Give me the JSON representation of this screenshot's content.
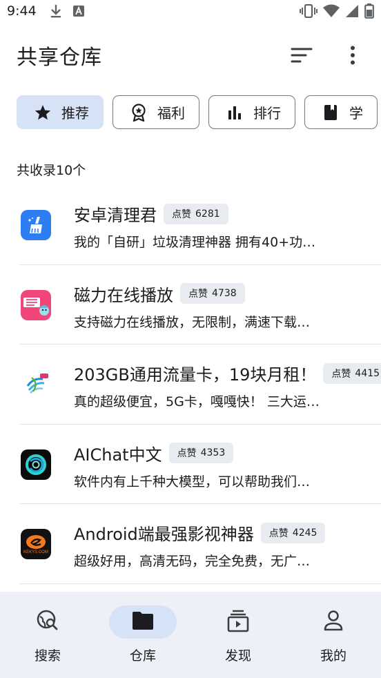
{
  "status_bar": {
    "time": "9:44",
    "left_icons": [
      "download-icon",
      "text-a-icon"
    ],
    "right_icons": [
      "vibrate-icon",
      "wifi-icon",
      "signal-icon",
      "battery-icon"
    ]
  },
  "app_bar": {
    "title": "共享仓库",
    "actions": [
      "sort-icon",
      "more-vert-icon"
    ]
  },
  "chips": [
    {
      "label": "推荐",
      "icon": "star-icon",
      "selected": true
    },
    {
      "label": "福利",
      "icon": "award-icon",
      "selected": false
    },
    {
      "label": "排行",
      "icon": "bar-chart-icon",
      "selected": false
    },
    {
      "label": "学",
      "icon": "book-icon",
      "selected": false
    }
  ],
  "count_label": "共收录10个",
  "items": [
    {
      "title": "安卓清理君",
      "likes_label": "点赞",
      "likes": "6281",
      "desc": "我的「自研」垃圾清理神器 拥有40+功…",
      "icon": "broom-app-icon",
      "icon_bg": "#2d7ef3"
    },
    {
      "title": "磁力在线播放",
      "likes_label": "点赞",
      "likes": "4738",
      "desc": "支持磁力在线播放，无限制，满速下载…",
      "icon": "magnet-app-icon",
      "icon_bg": "#f0467a"
    },
    {
      "title": "203GB通用流量卡，19块月租！",
      "likes_label": "点赞",
      "likes": "4415",
      "desc": "真的超级便宜，5G卡，嘎嘎快！ 三大运…",
      "icon": "china-mobile-icon",
      "icon_bg": "#ffffff"
    },
    {
      "title": "AIChat中文",
      "likes_label": "点赞",
      "likes": "4353",
      "desc": "软件内有上千种大模型，可以帮助我们…",
      "icon": "aichat-app-icon",
      "icon_bg": "#0b0b0b"
    },
    {
      "title": "Android端最强影视神器",
      "likes_label": "点赞",
      "likes": "4245",
      "desc": "超级好用，高清无码，完全免费，无广…",
      "icon": "kekys-app-icon",
      "icon_bg": "#111111",
      "icon_text": "KEKYS.COM"
    }
  ],
  "bottom_nav": [
    {
      "label": "搜索",
      "icon": "search-globe-icon",
      "active": false
    },
    {
      "label": "仓库",
      "icon": "folder-icon",
      "active": true
    },
    {
      "label": "发现",
      "icon": "discover-icon",
      "active": false
    },
    {
      "label": "我的",
      "icon": "person-icon",
      "active": false
    }
  ],
  "colors": {
    "accent_container": "#d6e3f7",
    "nav_background": "#edf1f7",
    "badge_background": "#e8ecf1"
  }
}
